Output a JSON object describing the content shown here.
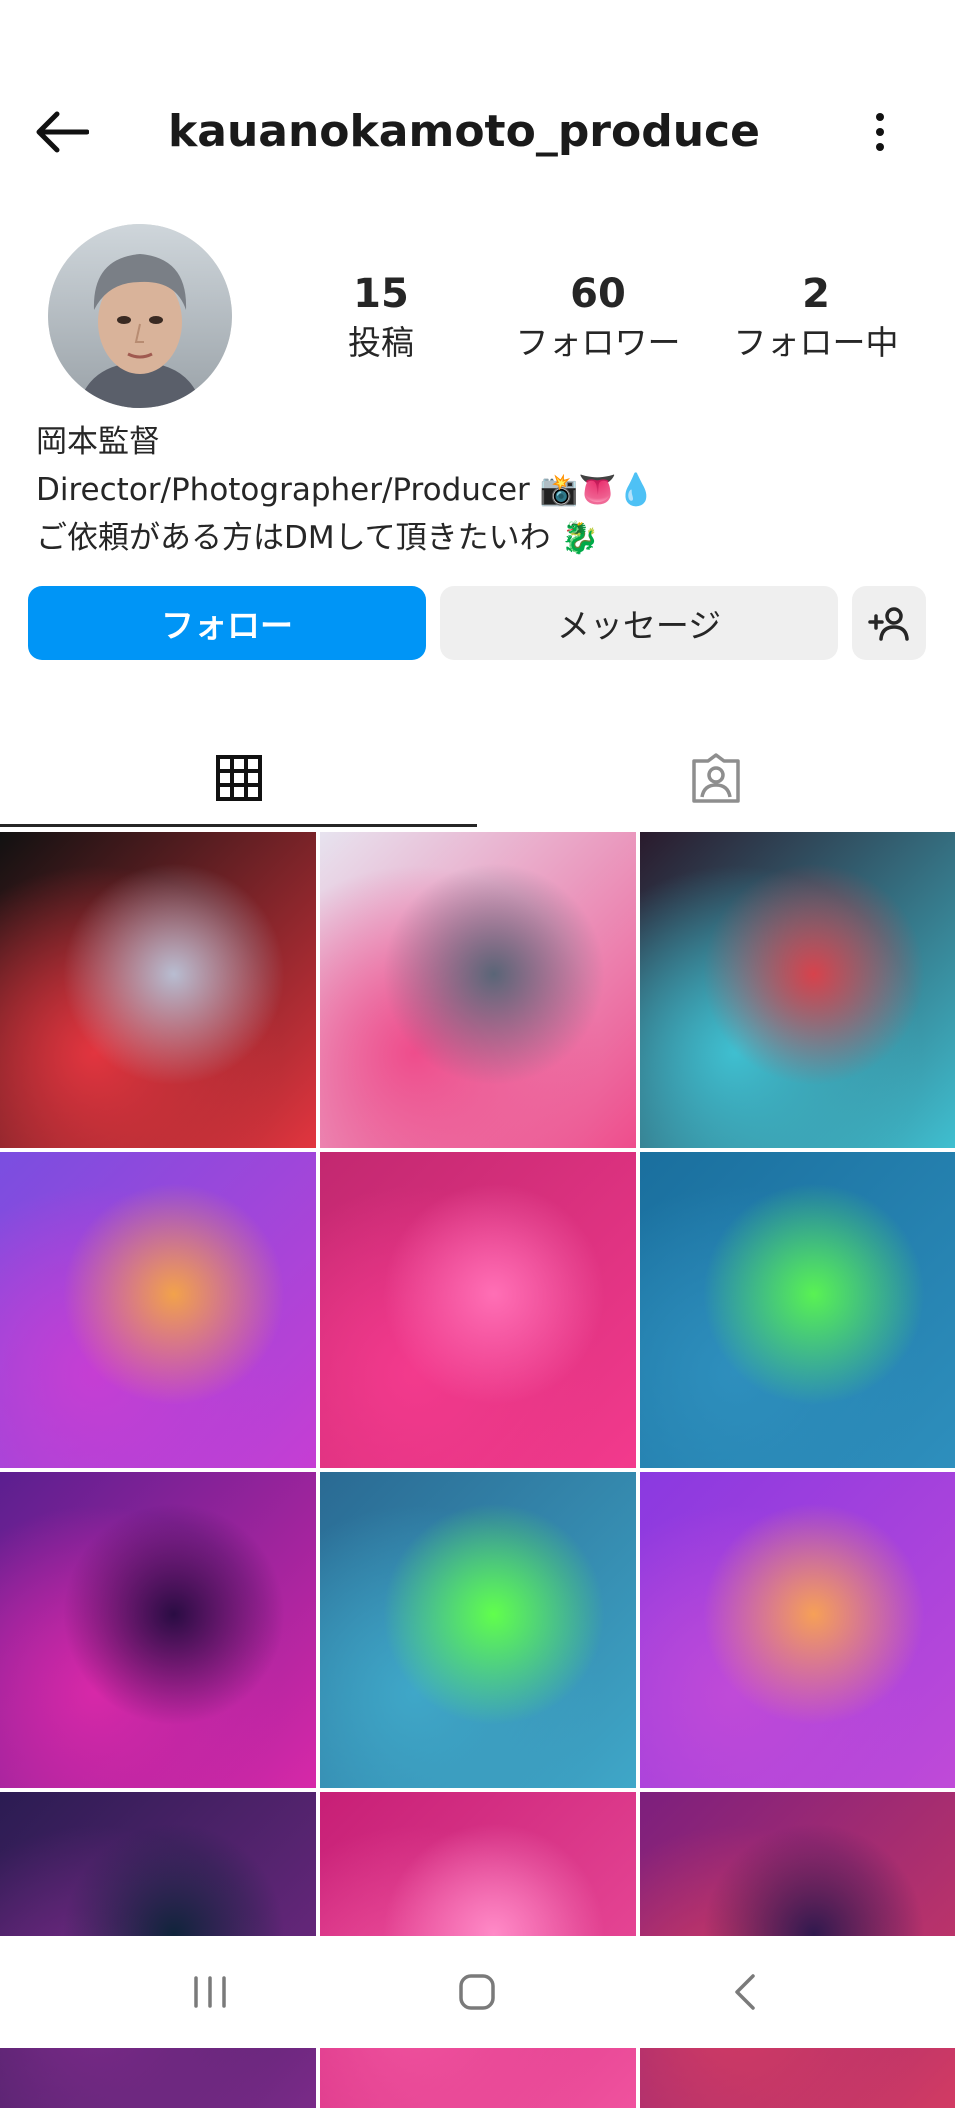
{
  "header": {
    "username": "kauanokamoto_produce",
    "back_icon": "arrow-left-icon",
    "more_icon": "more-vertical-icon"
  },
  "profile": {
    "posts": {
      "count": "15",
      "label": "投稿"
    },
    "followers": {
      "count": "60",
      "label": "フォロワー"
    },
    "following": {
      "count": "2",
      "label": "フォロー中"
    }
  },
  "bio": {
    "name": "岡本監督",
    "line1_text": "Director/Photographer/Producer",
    "line1_emoji": "📸👅💧",
    "line2_text": "ご依頼がある方はDMして頂きたいわ",
    "line2_emoji": "🐉"
  },
  "actions": {
    "follow": "フォロー",
    "message": "メッセージ",
    "add_person_icon": "add-person-icon"
  },
  "tabs": [
    {
      "icon": "grid-icon",
      "selected": true
    },
    {
      "icon": "tagged-person-icon",
      "selected": false
    }
  ],
  "grid": [
    {
      "row": 0,
      "col": 0,
      "colors": [
        "#111111",
        "#e2353f",
        "#b8bdd1"
      ]
    },
    {
      "row": 0,
      "col": 1,
      "colors": [
        "#e7e3ef",
        "#ee4d8c",
        "#5a6577"
      ]
    },
    {
      "row": 0,
      "col": 2,
      "colors": [
        "#2a1a2c",
        "#3fbfd0",
        "#d7424c"
      ]
    },
    {
      "row": 1,
      "col": 0,
      "colors": [
        "#7a4ee0",
        "#c63ed3",
        "#f2a24b"
      ]
    },
    {
      "row": 1,
      "col": 1,
      "colors": [
        "#c22870",
        "#f33a8d",
        "#ff6fb5"
      ]
    },
    {
      "row": 1,
      "col": 2,
      "colors": [
        "#1a6f9e",
        "#2e8fbd",
        "#59f253"
      ]
    },
    {
      "row": 2,
      "col": 0,
      "colors": [
        "#5b1f8f",
        "#d728a8",
        "#2a0c43"
      ]
    },
    {
      "row": 2,
      "col": 1,
      "colors": [
        "#2a6a93",
        "#3fa7c8",
        "#61ff4c"
      ]
    },
    {
      "row": 2,
      "col": 2,
      "colors": [
        "#8a39e0",
        "#c04ad8",
        "#f6a057"
      ]
    },
    {
      "row": 3,
      "col": 0,
      "colors": [
        "#2b1c52",
        "#7a2a88",
        "#10243b"
      ]
    },
    {
      "row": 3,
      "col": 1,
      "colors": [
        "#c71f76",
        "#f0529e",
        "#ff8ac7"
      ]
    },
    {
      "row": 3,
      "col": 2,
      "colors": [
        "#7c1f7d",
        "#d23b63",
        "#30194e"
      ]
    }
  ],
  "navbar": {
    "recents_icon": "recent-apps-icon",
    "home_icon": "home-icon",
    "back_icon": "back-icon"
  }
}
